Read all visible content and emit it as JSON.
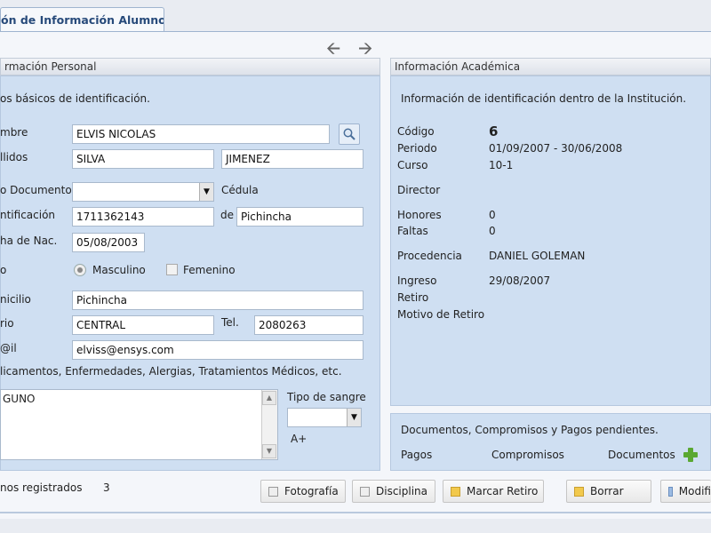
{
  "tab": {
    "title": "ón de Información Alumnos"
  },
  "personal": {
    "title": "rmación Personal",
    "subtitle": "os básicos de identificación.",
    "labels": {
      "nombre": "mbre",
      "apellidos": "llidos",
      "tipo_documento": "o Documento",
      "identificacion": "ntificación",
      "fecha_nac": "ha de Nac.",
      "sexo": "o",
      "domicilio": "nicilio",
      "barrio": "rio",
      "email": "@il",
      "meds": "licamentos, Enfermedades, Alergias, Tratamientos Médicos, etc.",
      "cedula": "Cédula",
      "de": "de",
      "tel": "Tel.",
      "masculino": "Masculino",
      "femenino": "Femenino",
      "tipo_sangre": "Tipo de sangre"
    },
    "values": {
      "nombre": "ELVIS NICOLAS",
      "apellido1": "SILVA",
      "apellido2": "JIMENEZ",
      "tipo_documento": "",
      "identificacion": "1711362143",
      "provincia": "Pichincha",
      "fecha_nac": "05/08/2003",
      "domicilio": "Pichincha",
      "barrio": "CENTRAL",
      "telefono": "2080263",
      "email": "elviss@ensys.com",
      "meds": "GUNO",
      "tipo_sangre_select": "",
      "tipo_sangre": "A+"
    }
  },
  "academic": {
    "title": "Información Académica",
    "subtitle": "Información de identificación dentro de la Institución.",
    "labels": {
      "codigo": "Código",
      "periodo": "Periodo",
      "curso": "Curso",
      "director": "Director",
      "honores": "Honores",
      "faltas": "Faltas",
      "procedencia": "Procedencia",
      "ingreso": "Ingreso",
      "retiro": "Retiro",
      "motivo": "Motivo de Retiro"
    },
    "values": {
      "codigo": "6",
      "periodo": "01/09/2007 - 30/06/2008",
      "curso": "10-1",
      "director": "",
      "honores": "0",
      "faltas": "0",
      "procedencia": "DANIEL GOLEMAN",
      "ingreso": "29/08/2007",
      "retiro": "",
      "motivo": ""
    }
  },
  "pending": {
    "title": "Documentos, Compromisos y Pagos pendientes.",
    "pagos": "Pagos",
    "compromisos": "Compromisos",
    "documentos": "Documentos"
  },
  "footer": {
    "registered_label": "nos registrados",
    "registered_count": "3",
    "buttons": {
      "fotografia": "Fotografía",
      "disciplina": "Disciplina",
      "marcar_retiro": "Marcar Retiro",
      "borrar": "Borrar",
      "modificar": "Modifi"
    }
  },
  "colors": {
    "panel_bg": "#cfdff2",
    "tab_text": "#274a7a",
    "yellow_icon": "#f2c94c",
    "blue_icon": "#9cbbe3",
    "plus_green": "#5aa832"
  }
}
